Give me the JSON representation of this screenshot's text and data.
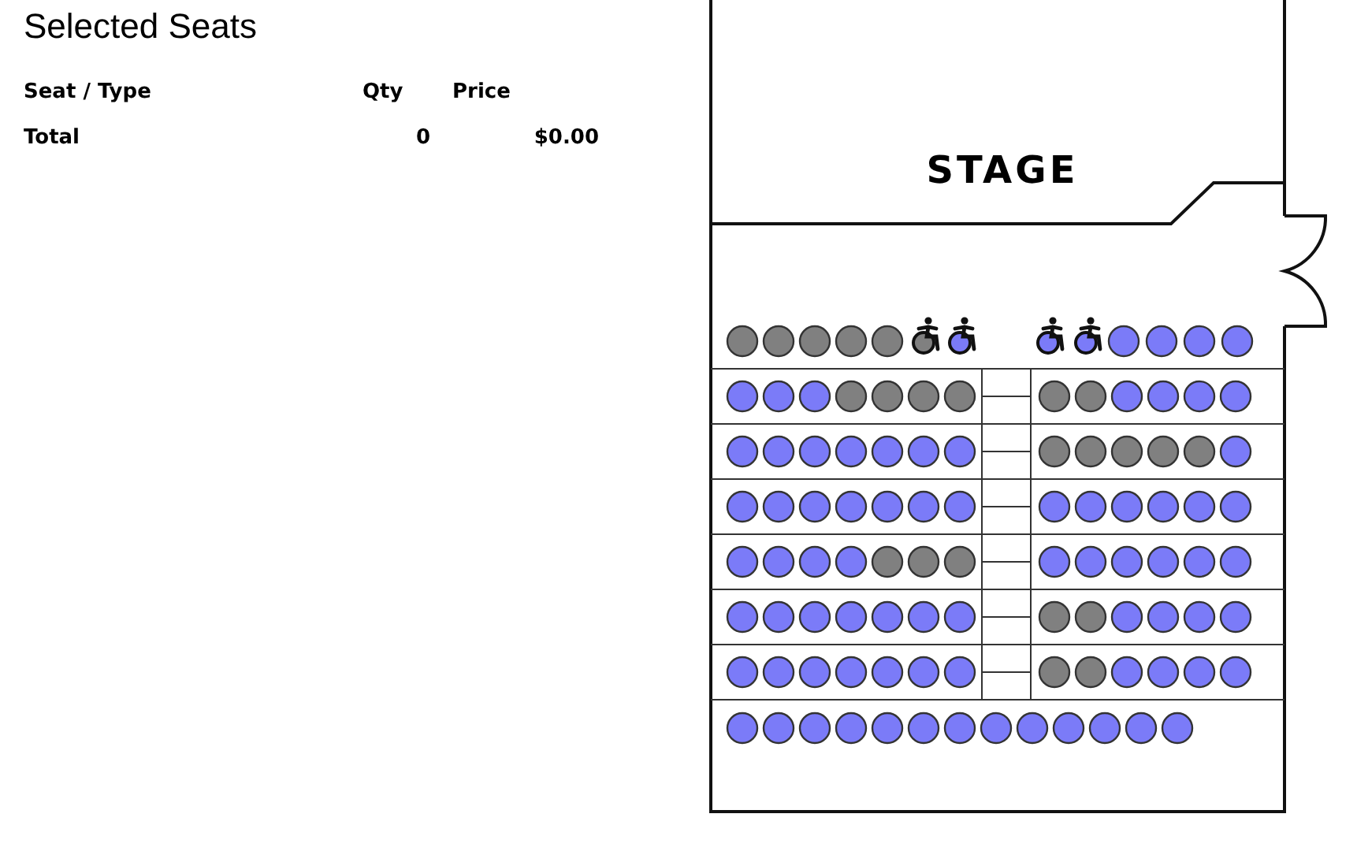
{
  "summary": {
    "title": "Selected Seats",
    "columns": [
      "Seat / Type",
      "Qty",
      "Price"
    ],
    "total": {
      "label": "Total",
      "qty": "0",
      "price": "$0.00"
    }
  },
  "map": {
    "stage_label": "STAGE",
    "rows": [
      {
        "kind": "front",
        "sections": [
          [
            {
              "kind": "standard",
              "available": false
            },
            {
              "kind": "standard",
              "available": false
            },
            {
              "kind": "standard",
              "available": false
            },
            {
              "kind": "standard",
              "available": false
            },
            {
              "kind": "standard",
              "available": false
            },
            {
              "kind": "wheelchair",
              "available": false
            },
            {
              "kind": "wheelchair",
              "available": true
            }
          ],
          [
            {
              "kind": "wheelchair",
              "available": true
            },
            {
              "kind": "wheelchair",
              "available": true
            },
            {
              "kind": "standard",
              "available": true
            },
            {
              "kind": "standard",
              "available": true
            },
            {
              "kind": "standard",
              "available": true
            },
            {
              "kind": "standard",
              "available": true
            }
          ]
        ]
      },
      {
        "kind": "aisle",
        "sections": [
          [
            {
              "kind": "standard",
              "available": true
            },
            {
              "kind": "standard",
              "available": true
            },
            {
              "kind": "standard",
              "available": true
            },
            {
              "kind": "standard",
              "available": false
            },
            {
              "kind": "standard",
              "available": false
            },
            {
              "kind": "standard",
              "available": false
            },
            {
              "kind": "standard",
              "available": false
            }
          ],
          [
            {
              "kind": "standard",
              "available": false
            },
            {
              "kind": "standard",
              "available": false
            },
            {
              "kind": "standard",
              "available": true
            },
            {
              "kind": "standard",
              "available": true
            },
            {
              "kind": "standard",
              "available": true
            },
            {
              "kind": "standard",
              "available": true
            }
          ]
        ]
      },
      {
        "kind": "aisle",
        "sections": [
          [
            {
              "kind": "standard",
              "available": true
            },
            {
              "kind": "standard",
              "available": true
            },
            {
              "kind": "standard",
              "available": true
            },
            {
              "kind": "standard",
              "available": true
            },
            {
              "kind": "standard",
              "available": true
            },
            {
              "kind": "standard",
              "available": true
            },
            {
              "kind": "standard",
              "available": true
            }
          ],
          [
            {
              "kind": "standard",
              "available": false
            },
            {
              "kind": "standard",
              "available": false
            },
            {
              "kind": "standard",
              "available": false
            },
            {
              "kind": "standard",
              "available": false
            },
            {
              "kind": "standard",
              "available": false
            },
            {
              "kind": "standard",
              "available": true
            }
          ]
        ]
      },
      {
        "kind": "aisle",
        "sections": [
          [
            {
              "kind": "standard",
              "available": true
            },
            {
              "kind": "standard",
              "available": true
            },
            {
              "kind": "standard",
              "available": true
            },
            {
              "kind": "standard",
              "available": true
            },
            {
              "kind": "standard",
              "available": true
            },
            {
              "kind": "standard",
              "available": true
            },
            {
              "kind": "standard",
              "available": true
            }
          ],
          [
            {
              "kind": "standard",
              "available": true
            },
            {
              "kind": "standard",
              "available": true
            },
            {
              "kind": "standard",
              "available": true
            },
            {
              "kind": "standard",
              "available": true
            },
            {
              "kind": "standard",
              "available": true
            },
            {
              "kind": "standard",
              "available": true
            }
          ]
        ]
      },
      {
        "kind": "aisle",
        "sections": [
          [
            {
              "kind": "standard",
              "available": true
            },
            {
              "kind": "standard",
              "available": true
            },
            {
              "kind": "standard",
              "available": true
            },
            {
              "kind": "standard",
              "available": true
            },
            {
              "kind": "standard",
              "available": false
            },
            {
              "kind": "standard",
              "available": false
            },
            {
              "kind": "standard",
              "available": false
            }
          ],
          [
            {
              "kind": "standard",
              "available": true
            },
            {
              "kind": "standard",
              "available": true
            },
            {
              "kind": "standard",
              "available": true
            },
            {
              "kind": "standard",
              "available": true
            },
            {
              "kind": "standard",
              "available": true
            },
            {
              "kind": "standard",
              "available": true
            }
          ]
        ]
      },
      {
        "kind": "aisle",
        "sections": [
          [
            {
              "kind": "standard",
              "available": true
            },
            {
              "kind": "standard",
              "available": true
            },
            {
              "kind": "standard",
              "available": true
            },
            {
              "kind": "standard",
              "available": true
            },
            {
              "kind": "standard",
              "available": true
            },
            {
              "kind": "standard",
              "available": true
            },
            {
              "kind": "standard",
              "available": true
            }
          ],
          [
            {
              "kind": "standard",
              "available": false
            },
            {
              "kind": "standard",
              "available": false
            },
            {
              "kind": "standard",
              "available": true
            },
            {
              "kind": "standard",
              "available": true
            },
            {
              "kind": "standard",
              "available": true
            },
            {
              "kind": "standard",
              "available": true
            }
          ]
        ]
      },
      {
        "kind": "aisle",
        "sections": [
          [
            {
              "kind": "standard",
              "available": true
            },
            {
              "kind": "standard",
              "available": true
            },
            {
              "kind": "standard",
              "available": true
            },
            {
              "kind": "standard",
              "available": true
            },
            {
              "kind": "standard",
              "available": true
            },
            {
              "kind": "standard",
              "available": true
            },
            {
              "kind": "standard",
              "available": true
            }
          ],
          [
            {
              "kind": "standard",
              "available": false
            },
            {
              "kind": "standard",
              "available": false
            },
            {
              "kind": "standard",
              "available": true
            },
            {
              "kind": "standard",
              "available": true
            },
            {
              "kind": "standard",
              "available": true
            },
            {
              "kind": "standard",
              "available": true
            }
          ]
        ]
      },
      {
        "kind": "back",
        "sections": [
          [
            {
              "kind": "standard",
              "available": true
            },
            {
              "kind": "standard",
              "available": true
            },
            {
              "kind": "standard",
              "available": true
            },
            {
              "kind": "standard",
              "available": true
            },
            {
              "kind": "standard",
              "available": true
            },
            {
              "kind": "standard",
              "available": true
            },
            {
              "kind": "standard",
              "available": true
            },
            {
              "kind": "standard",
              "available": true
            },
            {
              "kind": "standard",
              "available": true
            },
            {
              "kind": "standard",
              "available": true
            },
            {
              "kind": "standard",
              "available": true
            },
            {
              "kind": "standard",
              "available": true
            },
            {
              "kind": "standard",
              "available": true
            }
          ]
        ]
      }
    ]
  }
}
